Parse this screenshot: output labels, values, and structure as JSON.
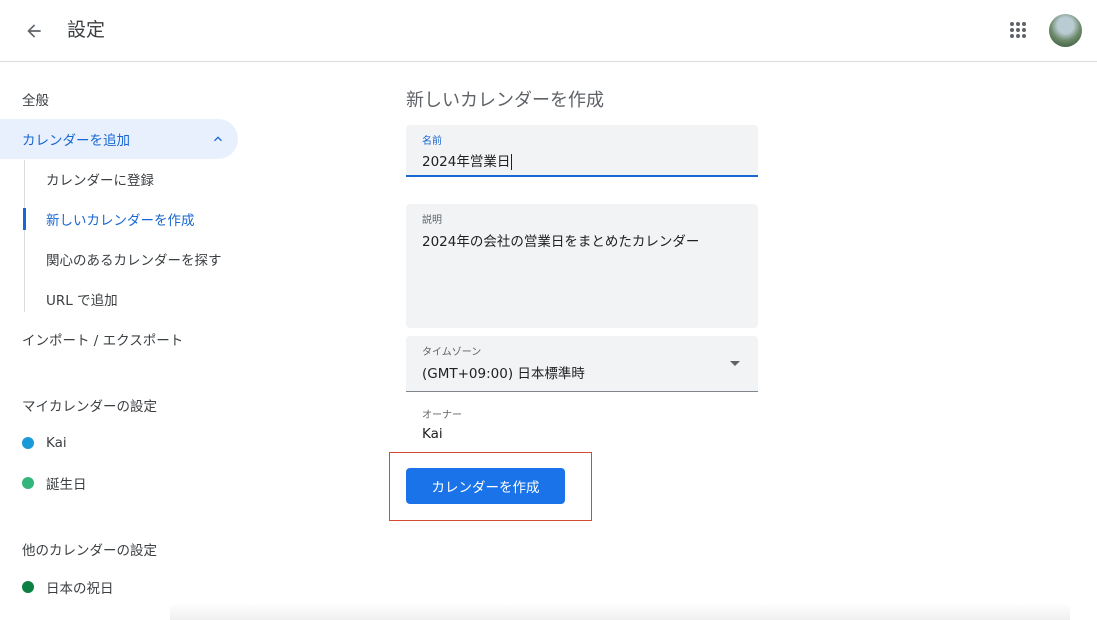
{
  "header": {
    "title": "設定",
    "back_icon": "arrow-back-icon",
    "apps_icon": "apps-grid-icon"
  },
  "sidebar": {
    "general": "全般",
    "add_calendar": "カレンダーを追加",
    "sub_items": [
      "カレンダーに登録",
      "新しいカレンダーを作成",
      "関心のあるカレンダーを探す",
      "URL で追加"
    ],
    "import_export": "インポート / エクスポート",
    "my_calendars_heading": "マイカレンダーの設定",
    "my_calendars": [
      {
        "name": "Kai",
        "color": "#1a9bd7"
      },
      {
        "name": "誕生日",
        "color": "#33b679"
      }
    ],
    "other_calendars_heading": "他のカレンダーの設定",
    "other_calendars": [
      {
        "name": "日本の祝日",
        "color": "#0b8043"
      }
    ]
  },
  "form": {
    "title": "新しいカレンダーを作成",
    "name_label": "名前",
    "name_value": "2024年営業日",
    "description_label": "説明",
    "description_value": "2024年の会社の営業日をまとめたカレンダー",
    "timezone_label": "タイムゾーン",
    "timezone_value": "(GMT+09:00) 日本標準時",
    "owner_label": "オーナー",
    "owner_value": "Kai",
    "create_button": "カレンダーを作成"
  },
  "colors": {
    "accent": "#1a73e8",
    "highlight_border": "#d64933"
  }
}
